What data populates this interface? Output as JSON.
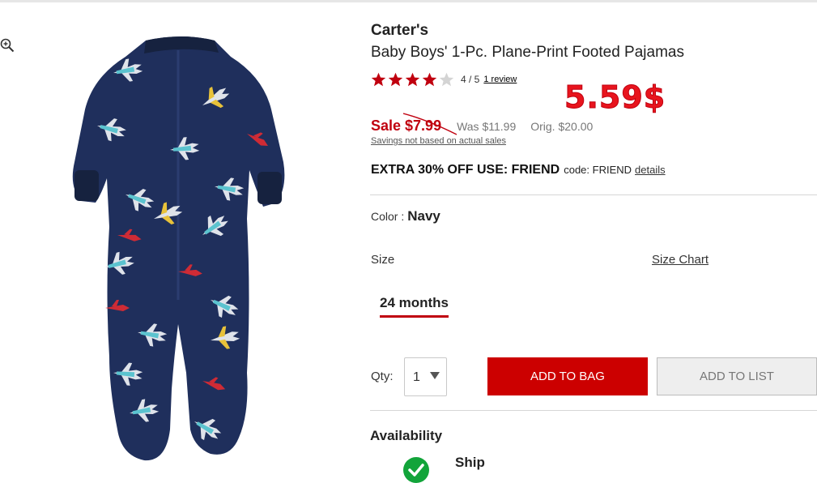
{
  "product": {
    "brand": "Carter's",
    "title": "Baby Boys' 1-Pc. Plane-Print Footed Pajamas",
    "image_icon": "plane-print-footed-pajamas"
  },
  "rating": {
    "stars": 4,
    "out_of": 5,
    "text": "4 / 5",
    "review_link": "1 review"
  },
  "annotation": "5.59$",
  "price": {
    "sale_label": "Sale",
    "sale_price": "$7.99",
    "was": "Was $11.99",
    "orig": "Orig. $20.00",
    "savings_note": "Savings not based on actual sales"
  },
  "promo": {
    "headline": "EXTRA 30% OFF USE: FRIEND",
    "code": "code: FRIEND",
    "details_link": "details"
  },
  "color": {
    "label": "Color :",
    "value": "Navy"
  },
  "size": {
    "label": "Size",
    "chart_link": "Size Chart",
    "selected": "24 months"
  },
  "purchase": {
    "qty_label": "Qty:",
    "qty_value": "1",
    "add_to_bag": "ADD TO BAG",
    "add_to_list": "ADD TO LIST"
  },
  "availability": {
    "heading": "Availability",
    "ship_label": "Ship"
  },
  "icons": {
    "zoom": "zoom-in-icon",
    "caret": "chevron-down-icon",
    "check": "check-circle-icon"
  },
  "colors": {
    "sale_red": "#c0000f",
    "bag_button": "#cc0000",
    "annotation_red": "#e8141d",
    "star_red": "#c0000f",
    "check_green": "#12a43a",
    "pajama_navy": "#1f2f5c"
  }
}
